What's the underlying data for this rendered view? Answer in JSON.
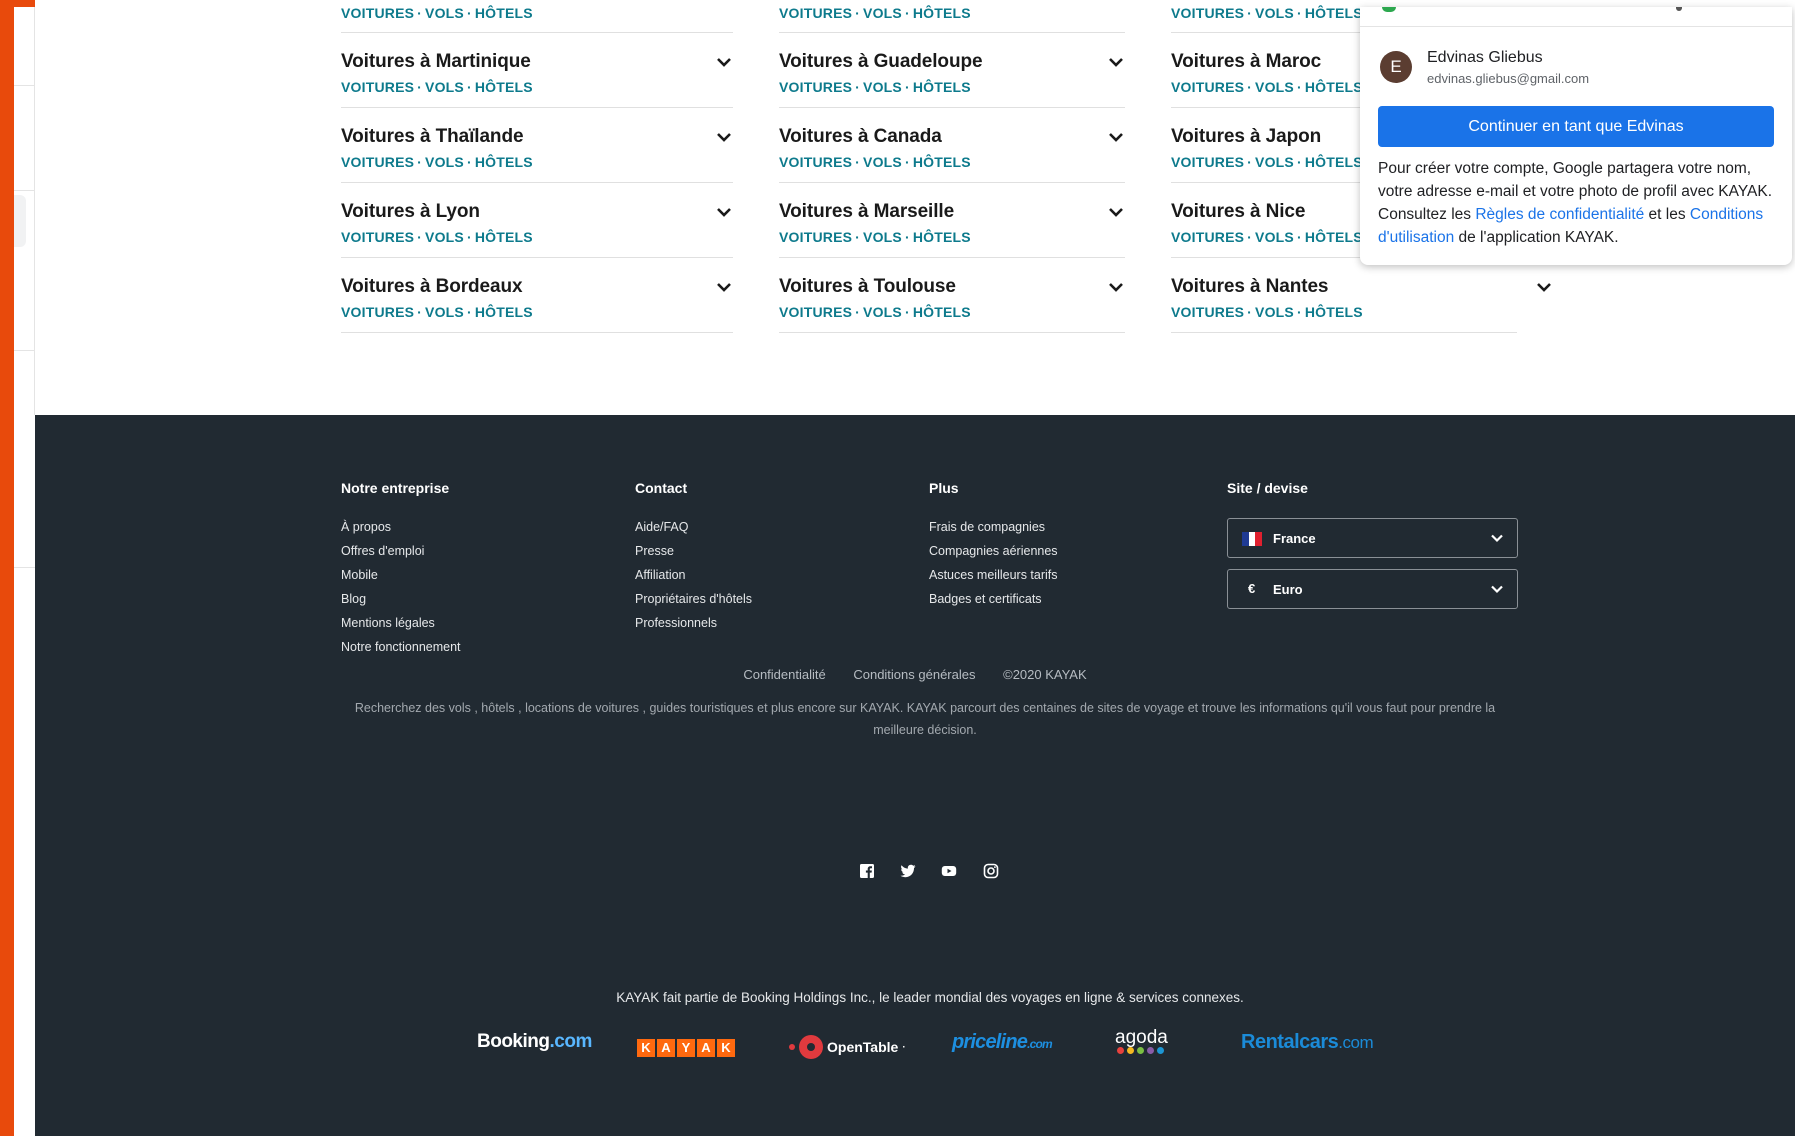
{
  "links_row": [
    "VOITURES",
    "VOLS",
    "HÔTELS"
  ],
  "destinations": {
    "col1": [
      {
        "title": "Voitures à Martinique"
      },
      {
        "title": "Voitures à Thaïlande"
      },
      {
        "title": "Voitures à Lyon"
      },
      {
        "title": "Voitures à Bordeaux"
      }
    ],
    "col2": [
      {
        "title": "Voitures à Guadeloupe"
      },
      {
        "title": "Voitures à Canada"
      },
      {
        "title": "Voitures à Marseille"
      },
      {
        "title": "Voitures à Toulouse"
      }
    ],
    "col3": [
      {
        "title": "Voitures à Maroc"
      },
      {
        "title": "Voitures à Japon"
      },
      {
        "title": "Voitures à Nice"
      },
      {
        "title": "Voitures à Nantes"
      }
    ]
  },
  "footer": {
    "company": {
      "heading": "Notre entreprise",
      "items": [
        "À propos",
        "Offres d'emploi",
        "Mobile",
        "Blog",
        "Mentions légales",
        "Notre fonctionnement"
      ]
    },
    "contact": {
      "heading": "Contact",
      "items": [
        "Aide/FAQ",
        "Presse",
        "Affiliation",
        "Propriétaires d'hôtels",
        "Professionnels"
      ]
    },
    "plus": {
      "heading": "Plus",
      "items": [
        "Frais de compagnies",
        "Compagnies aériennes",
        "Astuces meilleurs tarifs",
        "Badges et certificats"
      ]
    },
    "site": {
      "heading": "Site / devise",
      "country": "France",
      "currency_symbol": "€",
      "currency": "Euro"
    },
    "legal": [
      "Confidentialité",
      "Conditions générales",
      "©2020 KAYAK"
    ],
    "description": "Recherchez des vols , hôtels , locations de voitures , guides touristiques et plus encore sur KAYAK. KAYAK parcourt des centaines de sites de voyage et trouve les informations qu'il vous faut pour prendre la meilleure décision.",
    "holding": "KAYAK fait partie de Booking Holdings Inc., le leader mondial des voyages en ligne & services connexes.",
    "brands": {
      "booking_a": "Booking",
      "booking_b": ".com",
      "kayak": [
        "K",
        "A",
        "Y",
        "A",
        "K"
      ],
      "opentable": "OpenTable",
      "opentable_mark": "·",
      "priceline_a": "priceline",
      "priceline_b": ".com",
      "agoda": "agoda",
      "rentalcars_a": "Rentalcars",
      "rentalcars_b": ".com"
    }
  },
  "google_popup": {
    "avatar_letter": "E",
    "name": "Edvinas Gliebus",
    "email": "edvinas.gliebus@gmail.com",
    "continue_button": "Continuer en tant que Edvinas",
    "text_1": "Pour créer votre compte, Google partagera votre nom, votre adresse e-mail et votre photo de profil avec KAYAK. Consultez les ",
    "privacy_link": "Règles de confidentialité",
    "text_2": " et les ",
    "terms_link": "Conditions d'utilisation",
    "text_3": " de l'application KAYAK."
  },
  "colors": {
    "link_teal": "#0d7a8c",
    "footer_bg": "#212a32",
    "accent_orange": "#e84a0c",
    "google_blue": "#1a73e8",
    "kayak_orange": "#ff690f"
  }
}
